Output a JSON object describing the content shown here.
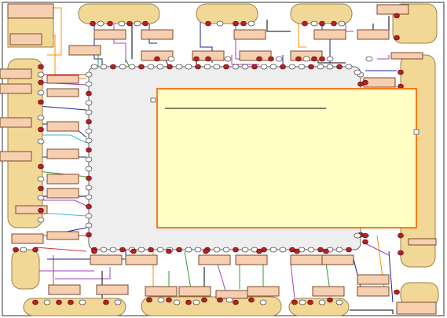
{
  "colors": {
    "background": "#ffffff",
    "core_fill": "#eeeeee",
    "module_fill": "#f2d896",
    "label_box_fill": "#f5cfb0",
    "pin_color": "#b22222",
    "highlight_fill": "#ffffc6",
    "highlight_border": "#ff7a1a",
    "wire_colors": [
      "#1f1fa0",
      "#cc3333",
      "#2aa02a",
      "#a040c0",
      "#ff8c00",
      "#3fb7e6",
      "#000000"
    ]
  },
  "icons": {
    "pin": "pin-icon",
    "pad": "pad-icon"
  }
}
